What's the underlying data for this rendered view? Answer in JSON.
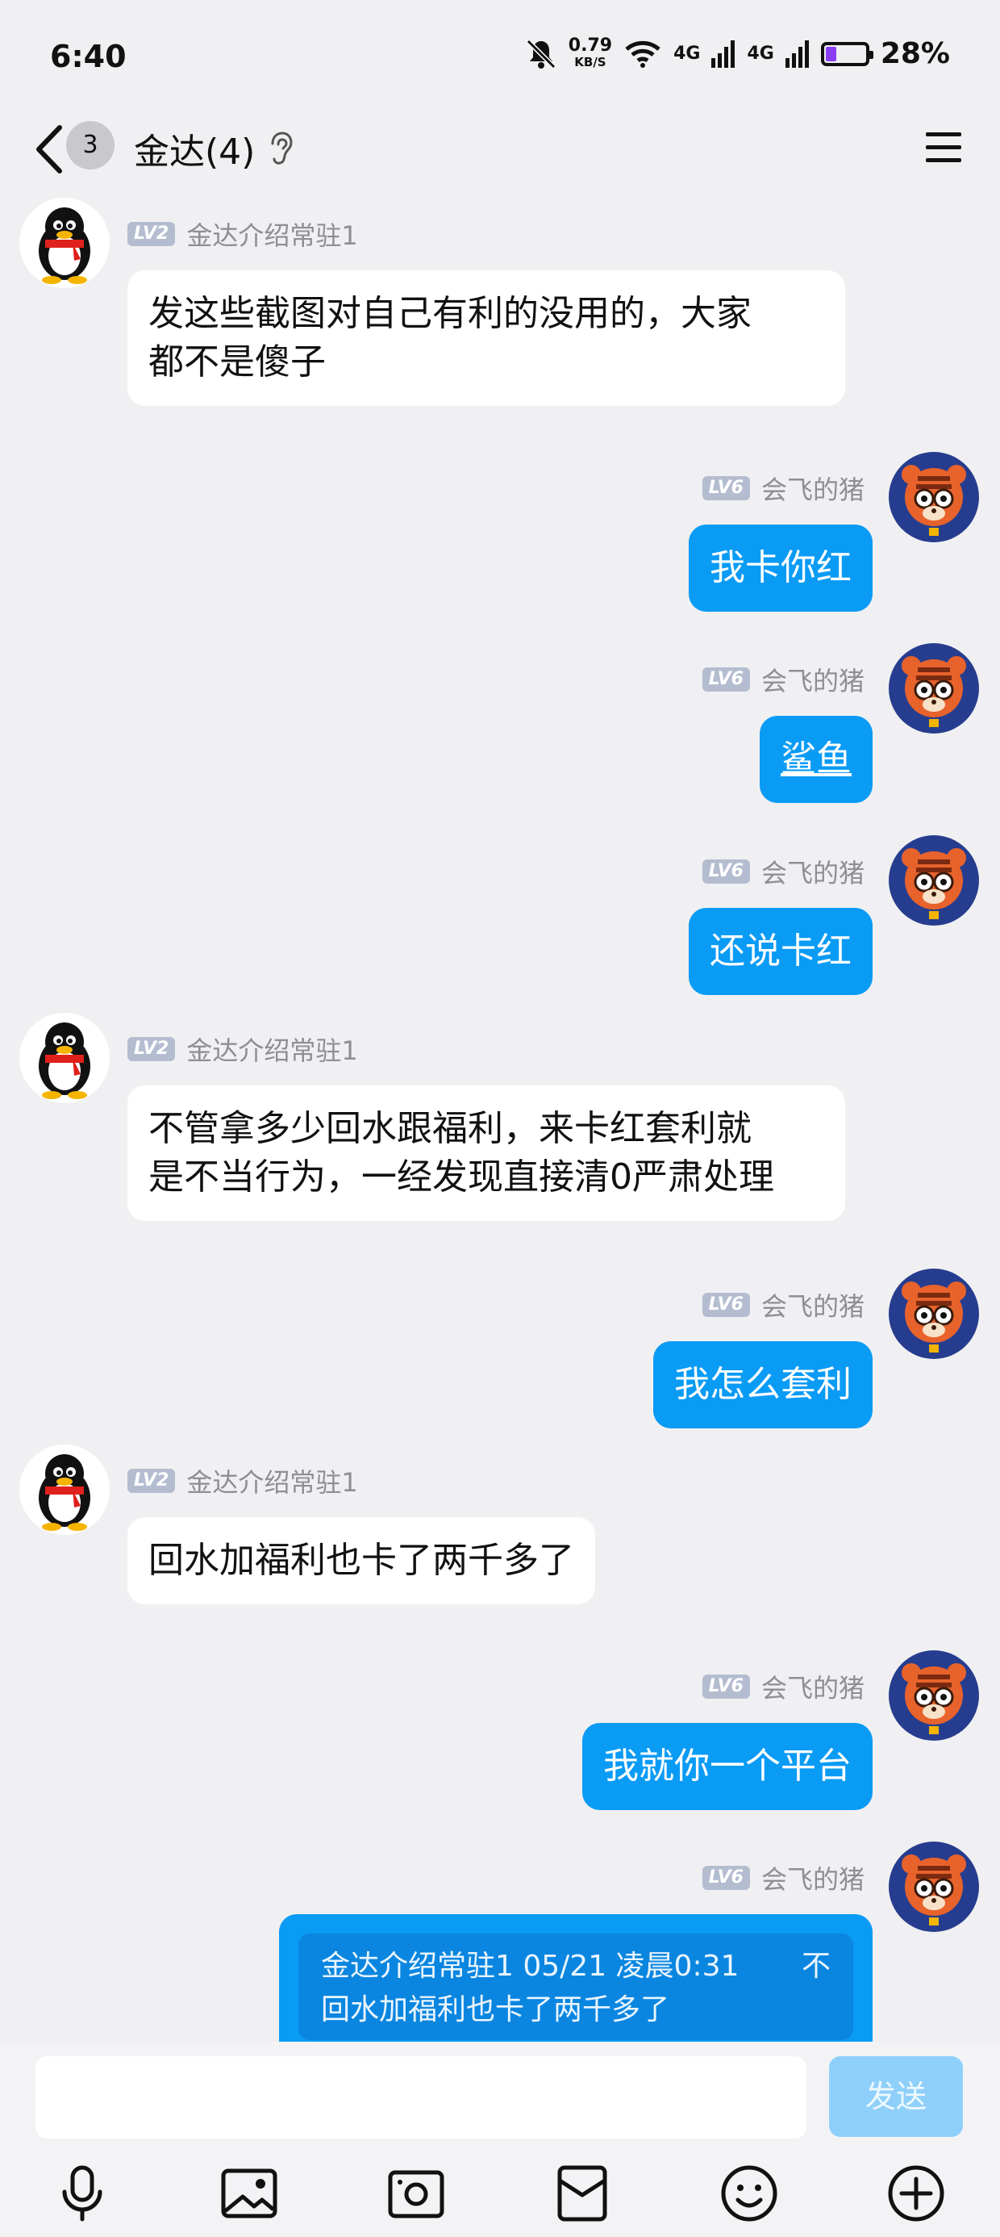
{
  "status": {
    "time": "6:40",
    "net_speed": "0.79",
    "net_unit": "KB/S",
    "signal1": "4G",
    "signal2": "4G",
    "battery": "28%",
    "battery_level": 0.28
  },
  "header": {
    "unread_count": "3",
    "title": "金达(4)"
  },
  "messages": [
    {
      "level": "LV2",
      "sender": "金达介绍常驻1",
      "text_line1": "发这些截图对自己有利的没用的，大家",
      "text_line2": "都不是傻子"
    },
    {
      "level": "LV6",
      "sender": "会飞的猪",
      "text": "我卡你红"
    },
    {
      "level": "LV6",
      "sender": "会飞的猪",
      "text": "鲨鱼"
    },
    {
      "level": "LV6",
      "sender": "会飞的猪",
      "text": "还说卡红"
    },
    {
      "level": "LV2",
      "sender": "金达介绍常驻1",
      "text_line1": "不管拿多少回水跟福利，来卡红套利就",
      "text_line2": "是不当行为，一经发现直接清0严肃处理"
    },
    {
      "level": "LV6",
      "sender": "会飞的猪",
      "text": "我怎么套利"
    },
    {
      "level": "LV2",
      "sender": "金达介绍常驻1",
      "text": "回水加福利也卡了两千多了"
    },
    {
      "level": "LV6",
      "sender": "会飞的猪",
      "text": "我就你一个平台"
    },
    {
      "level": "LV6",
      "sender": "会飞的猪",
      "quote_header": "金达介绍常驻1 05/21 凌晨0:31",
      "quote_extra": "不",
      "quote_text": "回水加福利也卡了两千多了"
    }
  ],
  "input": {
    "placeholder": "",
    "send_label": "发送"
  },
  "colors": {
    "accent": "#0a9bf5",
    "send_disabled": "#8fd0fa",
    "background": "#f0f0f2"
  },
  "icons": [
    "back-icon",
    "ear-icon",
    "menu-icon",
    "mic-icon",
    "image-icon",
    "camera-icon",
    "red-packet-icon",
    "emoji-icon",
    "plus-icon"
  ]
}
